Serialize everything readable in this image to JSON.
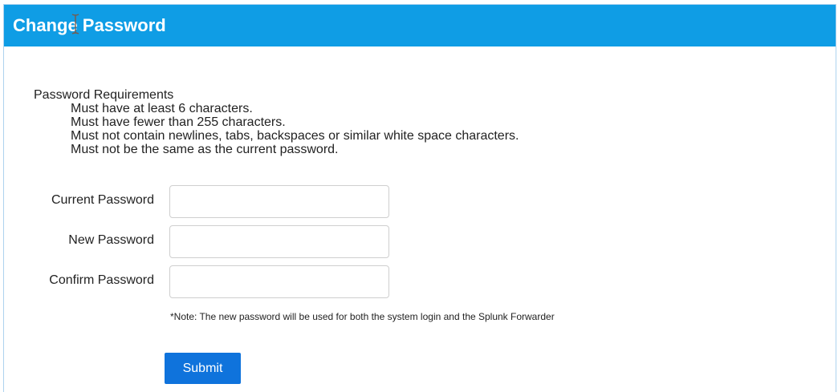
{
  "header": {
    "title": "Change Password"
  },
  "requirements": {
    "heading": "Password Requirements",
    "items": [
      "Must have at least 6 characters.",
      "Must have fewer than 255 characters.",
      "Must not contain newlines, tabs, backspaces or similar white space characters.",
      "Must not be the same as the current password."
    ]
  },
  "form": {
    "current_password": {
      "label": "Current Password",
      "value": ""
    },
    "new_password": {
      "label": "New Password",
      "value": ""
    },
    "confirm_password": {
      "label": "Confirm Password",
      "value": ""
    },
    "note": "*Note: The new password will be used for both the system login and the Splunk Forwarder",
    "submit_label": "Submit"
  },
  "colors": {
    "header_bg": "#0f9de5",
    "button_bg": "#0f73dc",
    "border": "#aed3ef"
  },
  "icons": {
    "cursor": "text-cursor-icon"
  }
}
